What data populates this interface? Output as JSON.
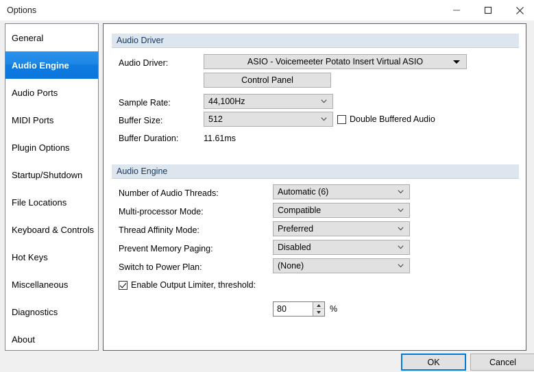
{
  "window": {
    "title": "Options",
    "controls": {
      "minimize": "minimize",
      "maximize": "maximize",
      "close": "close"
    }
  },
  "sidebar": {
    "selected": "Audio Engine",
    "items": [
      {
        "label": "General"
      },
      {
        "label": "Audio Engine"
      },
      {
        "label": "Audio Ports"
      },
      {
        "label": "MIDI Ports"
      },
      {
        "label": "Plugin Options"
      },
      {
        "label": "Startup/Shutdown"
      },
      {
        "label": "File Locations"
      },
      {
        "label": "Keyboard & Controls"
      },
      {
        "label": "Hot Keys"
      },
      {
        "label": "Miscellaneous"
      },
      {
        "label": "Diagnostics"
      },
      {
        "label": "About"
      }
    ]
  },
  "sections": {
    "audio_driver": {
      "title": "Audio Driver",
      "driver_label": "Audio Driver:",
      "driver_value": "ASIO - Voicemeeter Potato Insert Virtual ASIO",
      "control_panel_button": "Control Panel",
      "sample_rate_label": "Sample Rate:",
      "sample_rate_value": "44,100Hz",
      "buffer_size_label": "Buffer Size:",
      "buffer_size_value": "512",
      "double_buffered_label": "Double Buffered Audio",
      "double_buffered_checked": false,
      "buffer_duration_label": "Buffer Duration:",
      "buffer_duration_value": "11.61ms"
    },
    "audio_engine": {
      "title": "Audio Engine",
      "threads_label": "Number of Audio Threads:",
      "threads_value": "Automatic (6)",
      "multiproc_label": "Multi-processor Mode:",
      "multiproc_value": "Compatible",
      "affinity_label": "Thread Affinity Mode:",
      "affinity_value": "Preferred",
      "paging_label": "Prevent Memory Paging:",
      "paging_value": "Disabled",
      "power_plan_label": "Switch to Power Plan:",
      "power_plan_value": "(None)",
      "limiter_label": "Enable Output Limiter, threshold:",
      "limiter_checked": true,
      "limiter_value": "80",
      "limiter_unit": "%"
    }
  },
  "footer": {
    "ok_label": "OK",
    "cancel_label": "Cancel"
  },
  "colors": {
    "selection_blue": "#0f7ade",
    "section_header_bg": "#dde5ee",
    "section_header_text": "#17365d",
    "focus_border": "#0078d7",
    "dialog_bg": "#f0f0f0",
    "control_bg": "#e1e1e1"
  }
}
